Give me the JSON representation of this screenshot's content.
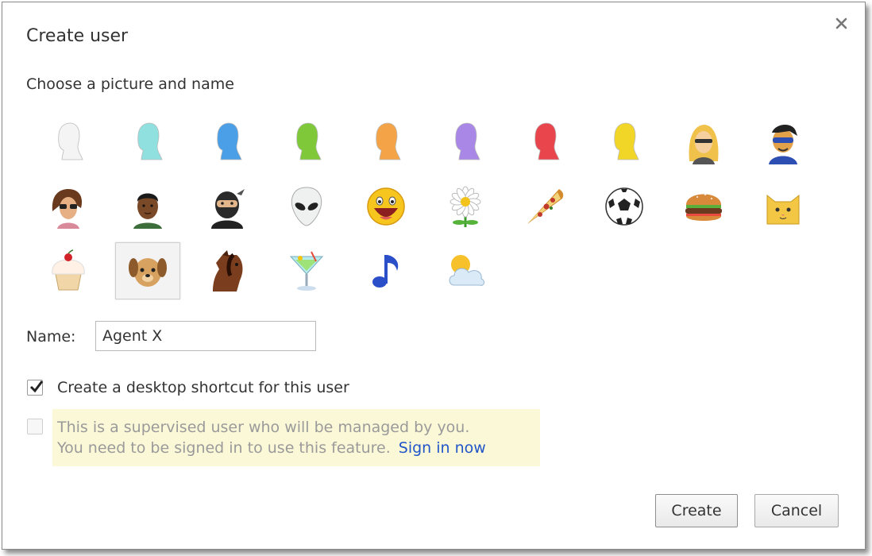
{
  "dialog": {
    "title": "Create user",
    "subtitle": "Choose a picture and name"
  },
  "avatars": [
    {
      "name": "white-silhouette",
      "color": "#f4f4f4"
    },
    {
      "name": "cyan-silhouette",
      "color": "#8fe0de"
    },
    {
      "name": "blue-silhouette",
      "color": "#4a9fe6"
    },
    {
      "name": "green-silhouette",
      "color": "#7ec83a"
    },
    {
      "name": "orange-silhouette",
      "color": "#f4a347"
    },
    {
      "name": "purple-silhouette",
      "color": "#a887e6"
    },
    {
      "name": "red-silhouette",
      "color": "#e8454d"
    },
    {
      "name": "yellow-silhouette",
      "color": "#f1d628"
    },
    {
      "name": "blonde-woman"
    },
    {
      "name": "superhero"
    },
    {
      "name": "woman-sunglasses"
    },
    {
      "name": "man"
    },
    {
      "name": "ninja"
    },
    {
      "name": "alien"
    },
    {
      "name": "smiley"
    },
    {
      "name": "daisy"
    },
    {
      "name": "pizza"
    },
    {
      "name": "soccer-ball"
    },
    {
      "name": "hamburger"
    },
    {
      "name": "cat"
    },
    {
      "name": "cupcake"
    },
    {
      "name": "dog",
      "selected": true
    },
    {
      "name": "horse"
    },
    {
      "name": "cocktail"
    },
    {
      "name": "music-note"
    },
    {
      "name": "sun-cloud"
    }
  ],
  "form": {
    "name_label": "Name:",
    "name_value": "Agent X",
    "shortcut_label": "Create a desktop shortcut for this user",
    "shortcut_checked": true,
    "supervised_line1": "This is a supervised user who will be managed by you.",
    "supervised_line2": "You need to be signed in to use this feature.",
    "signin_link": "Sign in now"
  },
  "buttons": {
    "create": "Create",
    "cancel": "Cancel"
  }
}
